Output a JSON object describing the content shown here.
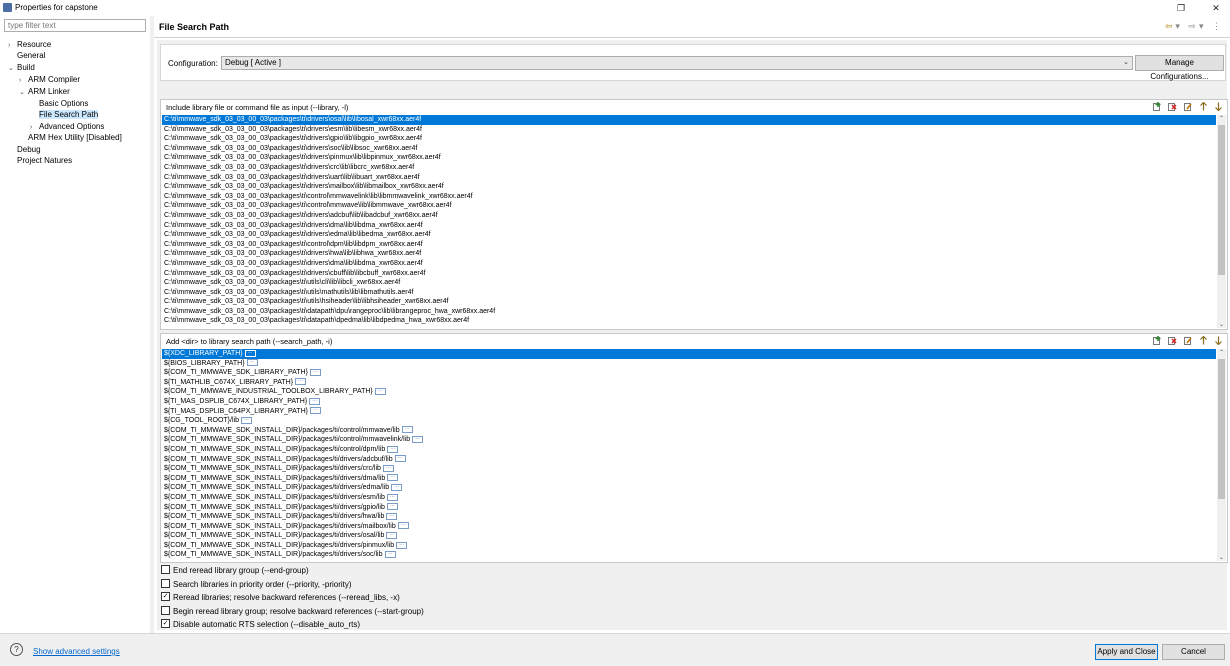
{
  "window": {
    "title": "Properties for capstone",
    "minimize_icon": "minimize-icon",
    "maximize_icon": "restore-icon",
    "close_icon": "close-icon"
  },
  "left_panel": {
    "filter_placeholder": "type filter text",
    "tree": [
      {
        "label": "Resource",
        "twisty": "›",
        "indent": 0
      },
      {
        "label": "General",
        "twisty": "",
        "indent": 0
      },
      {
        "label": "Build",
        "twisty": "⌄",
        "indent": 0
      },
      {
        "label": "ARM Compiler",
        "twisty": "›",
        "indent": 1
      },
      {
        "label": "ARM Linker",
        "twisty": "⌄",
        "indent": 1
      },
      {
        "label": "Basic Options",
        "twisty": "",
        "indent": 2
      },
      {
        "label": "File Search Path",
        "twisty": "",
        "indent": 2,
        "selected": true
      },
      {
        "label": "Advanced Options",
        "twisty": "›",
        "indent": 2
      },
      {
        "label": "ARM Hex Utility  [Disabled]",
        "twisty": "",
        "indent": 1
      },
      {
        "label": "Debug",
        "twisty": "",
        "indent": 0
      },
      {
        "label": "Project Natures",
        "twisty": "",
        "indent": 0
      }
    ]
  },
  "page": {
    "title": "File Search Path",
    "nav_back_icon": "back-arrow-icon",
    "nav_forward_icon": "forward-arrow-icon",
    "menu_icon": "view-menu-icon"
  },
  "configuration": {
    "label": "Configuration:",
    "value": "Debug  [ Active ]",
    "manage_button": "Manage Configurations..."
  },
  "library_group": {
    "title": "Include library file or command file as input (--library, -l)",
    "items": [
      "C:\\ti\\mmwave_sdk_03_03_00_03\\packages\\ti\\drivers\\osal\\lib\\libosal_xwr68xx.aer4f",
      "C:\\ti\\mmwave_sdk_03_03_00_03\\packages\\ti\\drivers\\esm\\lib\\libesm_xwr68xx.aer4f",
      "C:\\ti\\mmwave_sdk_03_03_00_03\\packages\\ti\\drivers\\gpio\\lib\\libgpio_xwr68xx.aer4f",
      "C:\\ti\\mmwave_sdk_03_03_00_03\\packages\\ti\\drivers\\soc\\lib\\libsoc_xwr68xx.aer4f",
      "C:\\ti\\mmwave_sdk_03_03_00_03\\packages\\ti\\drivers\\pinmux\\lib\\libpinmux_xwr68xx.aer4f",
      "C:\\ti\\mmwave_sdk_03_03_00_03\\packages\\ti\\drivers\\crc\\lib\\libcrc_xwr68xx.aer4f",
      "C:\\ti\\mmwave_sdk_03_03_00_03\\packages\\ti\\drivers\\uart\\lib\\libuart_xwr68xx.aer4f",
      "C:\\ti\\mmwave_sdk_03_03_00_03\\packages\\ti\\drivers\\mailbox\\lib\\libmailbox_xwr68xx.aer4f",
      "C:\\ti\\mmwave_sdk_03_03_00_03\\packages\\ti\\control\\mmwavelink\\lib\\libmmwavelink_xwr68xx.aer4f",
      "C:\\ti\\mmwave_sdk_03_03_00_03\\packages\\ti\\control\\mmwave\\lib\\libmmwave_xwr68xx.aer4f",
      "C:\\ti\\mmwave_sdk_03_03_00_03\\packages\\ti\\drivers\\adcbuf\\lib\\libadcbuf_xwr68xx.aer4f",
      "C:\\ti\\mmwave_sdk_03_03_00_03\\packages\\ti\\drivers\\dma\\lib\\libdma_xwr68xx.aer4f",
      "C:\\ti\\mmwave_sdk_03_03_00_03\\packages\\ti\\drivers\\edma\\lib\\libedma_xwr68xx.aer4f",
      "C:\\ti\\mmwave_sdk_03_03_00_03\\packages\\ti\\control\\dpm\\lib\\libdpm_xwr68xx.aer4f",
      "C:\\ti\\mmwave_sdk_03_03_00_03\\packages\\ti\\drivers\\hwa\\lib\\libhwa_xwr68xx.aer4f",
      "C:\\ti\\mmwave_sdk_03_03_00_03\\packages\\ti\\drivers\\dma\\lib\\libdma_xwr68xx.aer4f",
      "C:\\ti\\mmwave_sdk_03_03_00_03\\packages\\ti\\drivers\\cbuff\\lib\\libcbuff_xwr68xx.aer4f",
      "C:\\ti\\mmwave_sdk_03_03_00_03\\packages\\ti\\utils\\cli\\lib\\libcli_xwr68xx.aer4f",
      "C:\\ti\\mmwave_sdk_03_03_00_03\\packages\\ti\\utils\\mathutils\\lib\\libmathutils.aer4f",
      "C:\\ti\\mmwave_sdk_03_03_00_03\\packages\\ti\\utils\\hsiheader\\lib\\libhsiheader_xwr68xx.aer4f",
      "C:\\ti\\mmwave_sdk_03_03_00_03\\packages\\ti\\datapath\\dpu\\rangeproc\\lib\\librangeproc_hwa_xwr68xx.aer4f",
      "C:\\ti\\mmwave_sdk_03_03_00_03\\packages\\ti\\datapath\\dpedma\\lib\\libdpedma_hwa_xwr68xx.aer4f"
    ]
  },
  "search_group": {
    "title": "Add <dir> to library search path (--search_path, -i)",
    "items": [
      "${XDC_LIBRARY_PATH}",
      "${BIOS_LIBRARY_PATH}",
      "${COM_TI_MMWAVE_SDK_LIBRARY_PATH}",
      "${TI_MATHLIB_C674X_LIBRARY_PATH}",
      "${COM_TI_MMWAVE_INDUSTRIAL_TOOLBOX_LIBRARY_PATH}",
      "${TI_MAS_DSPLIB_C674X_LIBRARY_PATH}",
      "${TI_MAS_DSPLIB_C64PX_LIBRARY_PATH}",
      "${CG_TOOL_ROOT}/lib",
      "${COM_TI_MMWAVE_SDK_INSTALL_DIR}/packages/ti/control/mmwave/lib",
      "${COM_TI_MMWAVE_SDK_INSTALL_DIR}/packages/ti/control/mmwavelink/lib",
      "${COM_TI_MMWAVE_SDK_INSTALL_DIR}/packages/ti/control/dpm/lib",
      "${COM_TI_MMWAVE_SDK_INSTALL_DIR}/packages/ti/drivers/adcbuf/lib",
      "${COM_TI_MMWAVE_SDK_INSTALL_DIR}/packages/ti/drivers/crc/lib",
      "${COM_TI_MMWAVE_SDK_INSTALL_DIR}/packages/ti/drivers/dma/lib",
      "${COM_TI_MMWAVE_SDK_INSTALL_DIR}/packages/ti/drivers/edma/lib",
      "${COM_TI_MMWAVE_SDK_INSTALL_DIR}/packages/ti/drivers/esm/lib",
      "${COM_TI_MMWAVE_SDK_INSTALL_DIR}/packages/ti/drivers/gpio/lib",
      "${COM_TI_MMWAVE_SDK_INSTALL_DIR}/packages/ti/drivers/hwa/lib",
      "${COM_TI_MMWAVE_SDK_INSTALL_DIR}/packages/ti/drivers/mailbox/lib",
      "${COM_TI_MMWAVE_SDK_INSTALL_DIR}/packages/ti/drivers/osal/lib",
      "${COM_TI_MMWAVE_SDK_INSTALL_DIR}/packages/ti/drivers/pinmux/lib",
      "${COM_TI_MMWAVE_SDK_INSTALL_DIR}/packages/ti/drivers/soc/lib"
    ]
  },
  "group_icons": [
    "add-icon",
    "delete-icon",
    "edit-icon",
    "move-up-icon",
    "move-down-icon"
  ],
  "options": [
    {
      "label": "End reread library group (--end-group)",
      "checked": false
    },
    {
      "label": "Search libraries in priority order (--priority, -priority)",
      "checked": false
    },
    {
      "label": "Reread libraries; resolve backward references (--reread_libs, -x)",
      "checked": true
    },
    {
      "label": "Begin reread library group; resolve backward references (--start-group)",
      "checked": false
    },
    {
      "label": "Disable automatic RTS selection (--disable_auto_rts)",
      "checked": true
    }
  ],
  "footer": {
    "help_icon": "help-icon",
    "advanced_link": "Show advanced settings",
    "apply_close": "Apply and Close",
    "cancel": "Cancel"
  }
}
